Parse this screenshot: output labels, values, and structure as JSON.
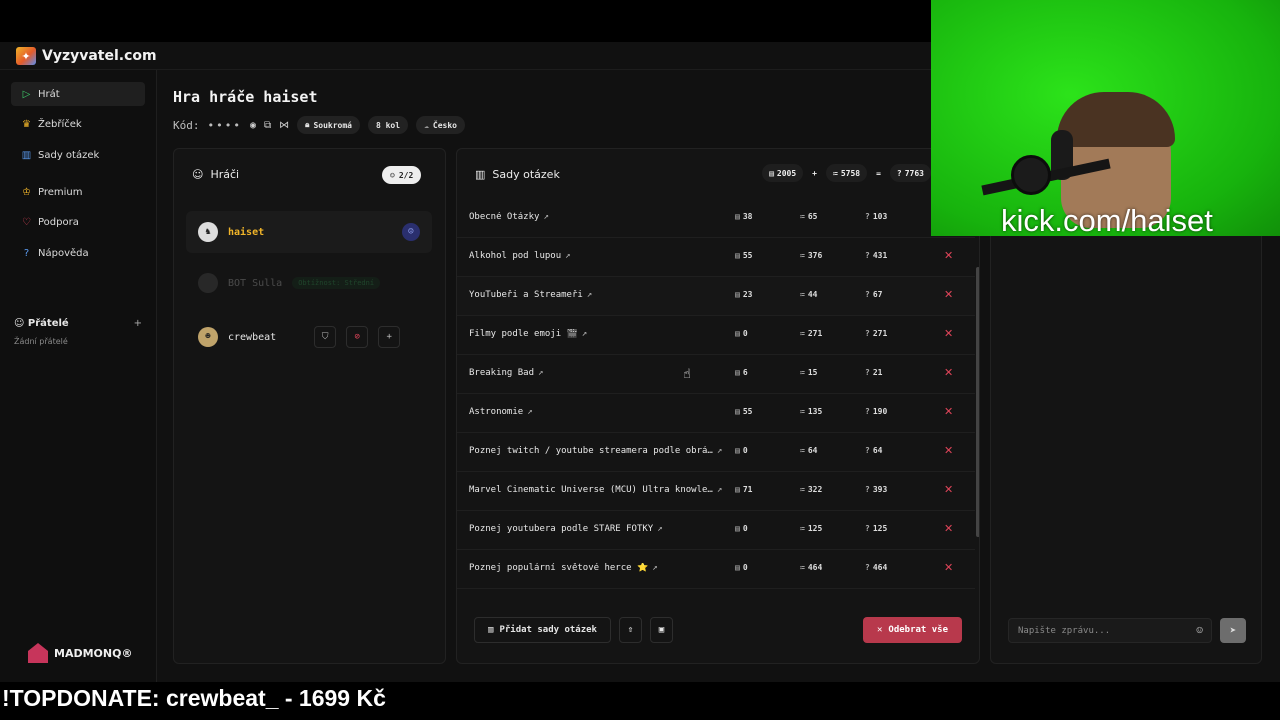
{
  "app": {
    "brand": "Vyzyvatel.com"
  },
  "nav": [
    {
      "label": "Hrát",
      "icon": "play-icon"
    },
    {
      "label": "Žebříček",
      "icon": "trophy-icon"
    },
    {
      "label": "Sady otázek",
      "icon": "book-icon"
    },
    {
      "label": "Premium",
      "icon": "crown-icon"
    },
    {
      "label": "Podpora",
      "icon": "heart-icon"
    },
    {
      "label": "Nápověda",
      "icon": "help-icon"
    }
  ],
  "friends": {
    "title": "Přátelé",
    "add": "+",
    "empty": "Žádní přátelé"
  },
  "sponsor": {
    "label": "MADMONQ®"
  },
  "game": {
    "title": "Hra hráče haiset",
    "code_label": "Kód:",
    "code_value": "••••",
    "privacy": "Soukromá",
    "rounds": "8 kol",
    "region": "Česko"
  },
  "players_panel": {
    "title": "Hráči",
    "count": "2/2",
    "players": [
      {
        "name": "haiset",
        "dim": false
      },
      {
        "name": "BOT Sulla",
        "difficulty": "Obtížnost: Střední",
        "dim": true
      },
      {
        "name": "crewbeat",
        "dim": false
      }
    ]
  },
  "sets_panel": {
    "title": "Sady otázek",
    "totals": {
      "a": "2005",
      "plus": "+",
      "b": "5758",
      "eq": "=",
      "c": "7763"
    },
    "rows": [
      {
        "name": "Obecné Otázky",
        "a": "38",
        "b": "65",
        "c": "103"
      },
      {
        "name": "Alkohol pod lupou",
        "a": "55",
        "b": "376",
        "c": "431"
      },
      {
        "name": "YouTubeři a Streameři",
        "a": "23",
        "b": "44",
        "c": "67"
      },
      {
        "name": "Filmy podle emoji 🎬",
        "a": "0",
        "b": "271",
        "c": "271"
      },
      {
        "name": "Breaking Bad",
        "a": "6",
        "b": "15",
        "c": "21"
      },
      {
        "name": "Astronomie",
        "a": "55",
        "b": "135",
        "c": "190"
      },
      {
        "name": "Poznej twitch / youtube streamera podle obrá…",
        "a": "0",
        "b": "64",
        "c": "64"
      },
      {
        "name": "Marvel Cinematic Universe (MCU) Ultra knowle…",
        "a": "71",
        "b": "322",
        "c": "393"
      },
      {
        "name": "Poznej youtubera podle STARÉ FOTKY",
        "a": "0",
        "b": "125",
        "c": "125"
      },
      {
        "name": "Poznej populární světové herce ⭐",
        "a": "0",
        "b": "464",
        "c": "464"
      }
    ],
    "add_label": "Přidat sady otázek",
    "remove_all_label": "Odebrat vše"
  },
  "chat": {
    "placeholder": "Napište zprávu..."
  },
  "overlay": {
    "kick_text": "kick.com/haiset",
    "donate_text": "!TOPDONATE: crewbeat_ - 1699 Kč"
  },
  "colors": {
    "danger": "#b8394c",
    "accent_gold": "#f0b429",
    "green_screen": "#1fc312"
  }
}
